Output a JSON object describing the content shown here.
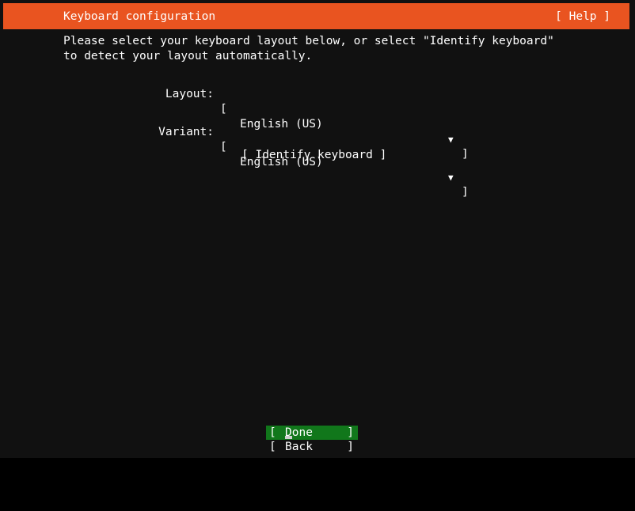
{
  "header": {
    "title": "Keyboard configuration",
    "help_label": "[ Help ]",
    "background_color": "#e95420",
    "text_color": "#ffffff"
  },
  "screen": {
    "background_color": "#111111",
    "foreground_color": "#ffffff"
  },
  "body": {
    "intro_text": "Please select your keyboard layout below, or select \"Identify keyboard\" to detect your layout automatically."
  },
  "form": {
    "rows": [
      {
        "label": "Layout:",
        "bracket_open": "[",
        "value": "English (US)",
        "arrow": "▼",
        "bracket_close": "]"
      },
      {
        "label": "Variant:",
        "bracket_open": "[",
        "value": "English (US)",
        "arrow": "▼",
        "bracket_close": "]"
      }
    ],
    "identify_label": "[ Identify keyboard ]"
  },
  "footer": {
    "buttons": [
      {
        "bracket_open": "[",
        "label": "Done",
        "bracket_close": "]",
        "selected": true,
        "highlight_color": "#11771b"
      },
      {
        "bracket_open": "[",
        "label": "Back",
        "bracket_close": "]",
        "selected": false,
        "highlight_color": ""
      }
    ]
  }
}
